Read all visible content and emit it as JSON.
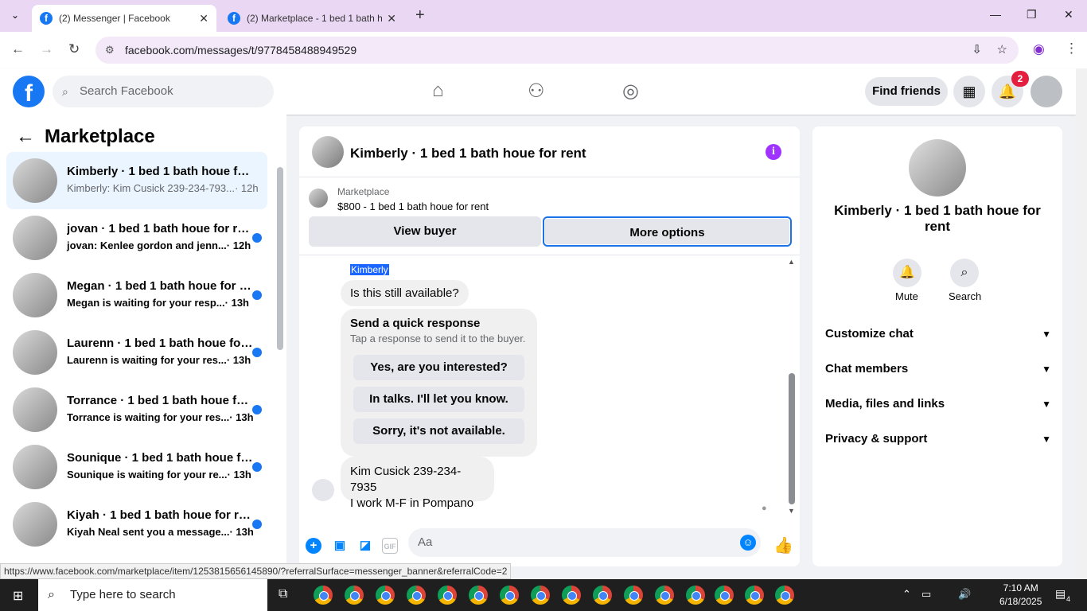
{
  "browser": {
    "tabs": [
      {
        "title": "(2) Messenger | Facebook"
      },
      {
        "title": "(2) Marketplace - 1 bed 1 bath h"
      }
    ],
    "url": "facebook.com/messages/t/9778458488949529",
    "status_url": "https://www.facebook.com/marketplace/item/1253815656145890/?referralSurface=messenger_banner&referralCode=2"
  },
  "header": {
    "search_placeholder": "Search Facebook",
    "find_friends": "Find friends",
    "notification_count": "2"
  },
  "sidebar": {
    "title": "Marketplace",
    "conversations": [
      {
        "title": "Kimberly · 1 bed 1 bath houe for rent",
        "preview": "Kimberly: Kim Cusick 239-234-793...",
        "time": "· 12h"
      },
      {
        "title": "jovan · 1 bed 1 bath houe for rent",
        "preview": "jovan: Kenlee gordon and jenn...",
        "time": "· 12h"
      },
      {
        "title": "Megan · 1 bed 1 bath houe for rent",
        "preview": "Megan is waiting for your resp...",
        "time": "· 13h"
      },
      {
        "title": "Laurenn · 1 bed 1 bath houe for rent",
        "preview": "Laurenn is waiting for your res...",
        "time": "· 13h"
      },
      {
        "title": "Torrance · 1 bed 1 bath houe for rent",
        "preview": "Torrance is waiting for your res...",
        "time": "· 13h"
      },
      {
        "title": "Sounique · 1 bed 1 bath houe for rent",
        "preview": "Sounique is waiting for your re...",
        "time": "· 13h"
      },
      {
        "title": "Kiyah · 1 bed 1 bath houe for rent",
        "preview": "Kiyah Neal sent you a message...",
        "time": "· 13h"
      }
    ]
  },
  "chat": {
    "title": "Kimberly · 1 bed 1 bath houe for rent",
    "banner_label": "Marketplace",
    "banner_item": "$800 - 1 bed 1 bath houe for rent",
    "view_buyer": "View buyer",
    "more_options": "More options",
    "sender": "Kimberly",
    "msg1": "Is this still available?",
    "quick_title": "Send a quick response",
    "quick_sub": "Tap a response to send it to the buyer.",
    "quick_replies": [
      "Yes, are you interested?",
      "In talks. I'll let you know.",
      "Sorry, it's not available."
    ],
    "msg2_line1": "Kim Cusick 239-234-7935",
    "msg2_line2": "I work M-F in Pompano",
    "composer_placeholder": "Aa"
  },
  "right_panel": {
    "name": "Kimberly · 1 bed 1 bath houe for rent",
    "mute": "Mute",
    "search": "Search",
    "rows": [
      "Customize chat",
      "Chat members",
      "Media, files and links",
      "Privacy & support"
    ]
  },
  "taskbar": {
    "search_placeholder": "Type here to search",
    "time": "7:10 AM",
    "date": "6/18/2025",
    "notif": "4"
  }
}
